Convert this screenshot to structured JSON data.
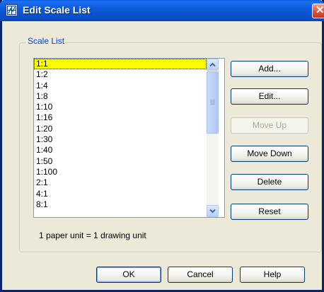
{
  "window": {
    "title": "Edit Scale List",
    "app_icon": "autocad-dialog-icon",
    "close_icon": "close-icon"
  },
  "group": {
    "label": "Scale List"
  },
  "scales": [
    "1:1",
    "1:2",
    "1:4",
    "1:8",
    "1:10",
    "1:16",
    "1:20",
    "1:30",
    "1:40",
    "1:50",
    "1:100",
    "2:1",
    "4:1",
    "8:1"
  ],
  "selected_scale": "1:1",
  "buttons": {
    "add": "Add...",
    "edit": "Edit...",
    "move_up": "Move Up",
    "move_down": "Move Down",
    "delete": "Delete",
    "reset": "Reset",
    "ok": "OK",
    "cancel": "Cancel",
    "help": "Help"
  },
  "disabled_buttons": [
    "move_up"
  ],
  "info_text": "1 paper unit = 1 drawing unit",
  "colors": {
    "selection": "#FFFF00",
    "titlebar": "#0A5EE6",
    "group_label": "#0046D5",
    "button_border": "#003C74"
  }
}
